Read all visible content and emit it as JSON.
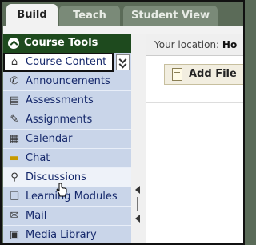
{
  "tabs": [
    {
      "label": "Build"
    },
    {
      "label": "Teach"
    },
    {
      "label": "Student View"
    }
  ],
  "course_tools": {
    "title": "Course Tools",
    "items": [
      {
        "label": "Course Content",
        "icon": "house-icon"
      },
      {
        "label": "Announcements",
        "icon": "megaphone-icon"
      },
      {
        "label": "Assessments",
        "icon": "clipboard-icon"
      },
      {
        "label": "Assignments",
        "icon": "pencil-paper-icon"
      },
      {
        "label": "Calendar",
        "icon": "calendar-icon"
      },
      {
        "label": "Chat",
        "icon": "speech-bubble-icon"
      },
      {
        "label": "Discussions",
        "icon": "pushpin-icon"
      },
      {
        "label": "Learning Modules",
        "icon": "book-icon"
      },
      {
        "label": "Mail",
        "icon": "envelope-icon"
      },
      {
        "label": "Media Library",
        "icon": "media-icon"
      }
    ]
  },
  "location": {
    "label": "Your location:",
    "value": "Ho"
  },
  "toolbar": {
    "add_file_label": "Add File"
  }
}
